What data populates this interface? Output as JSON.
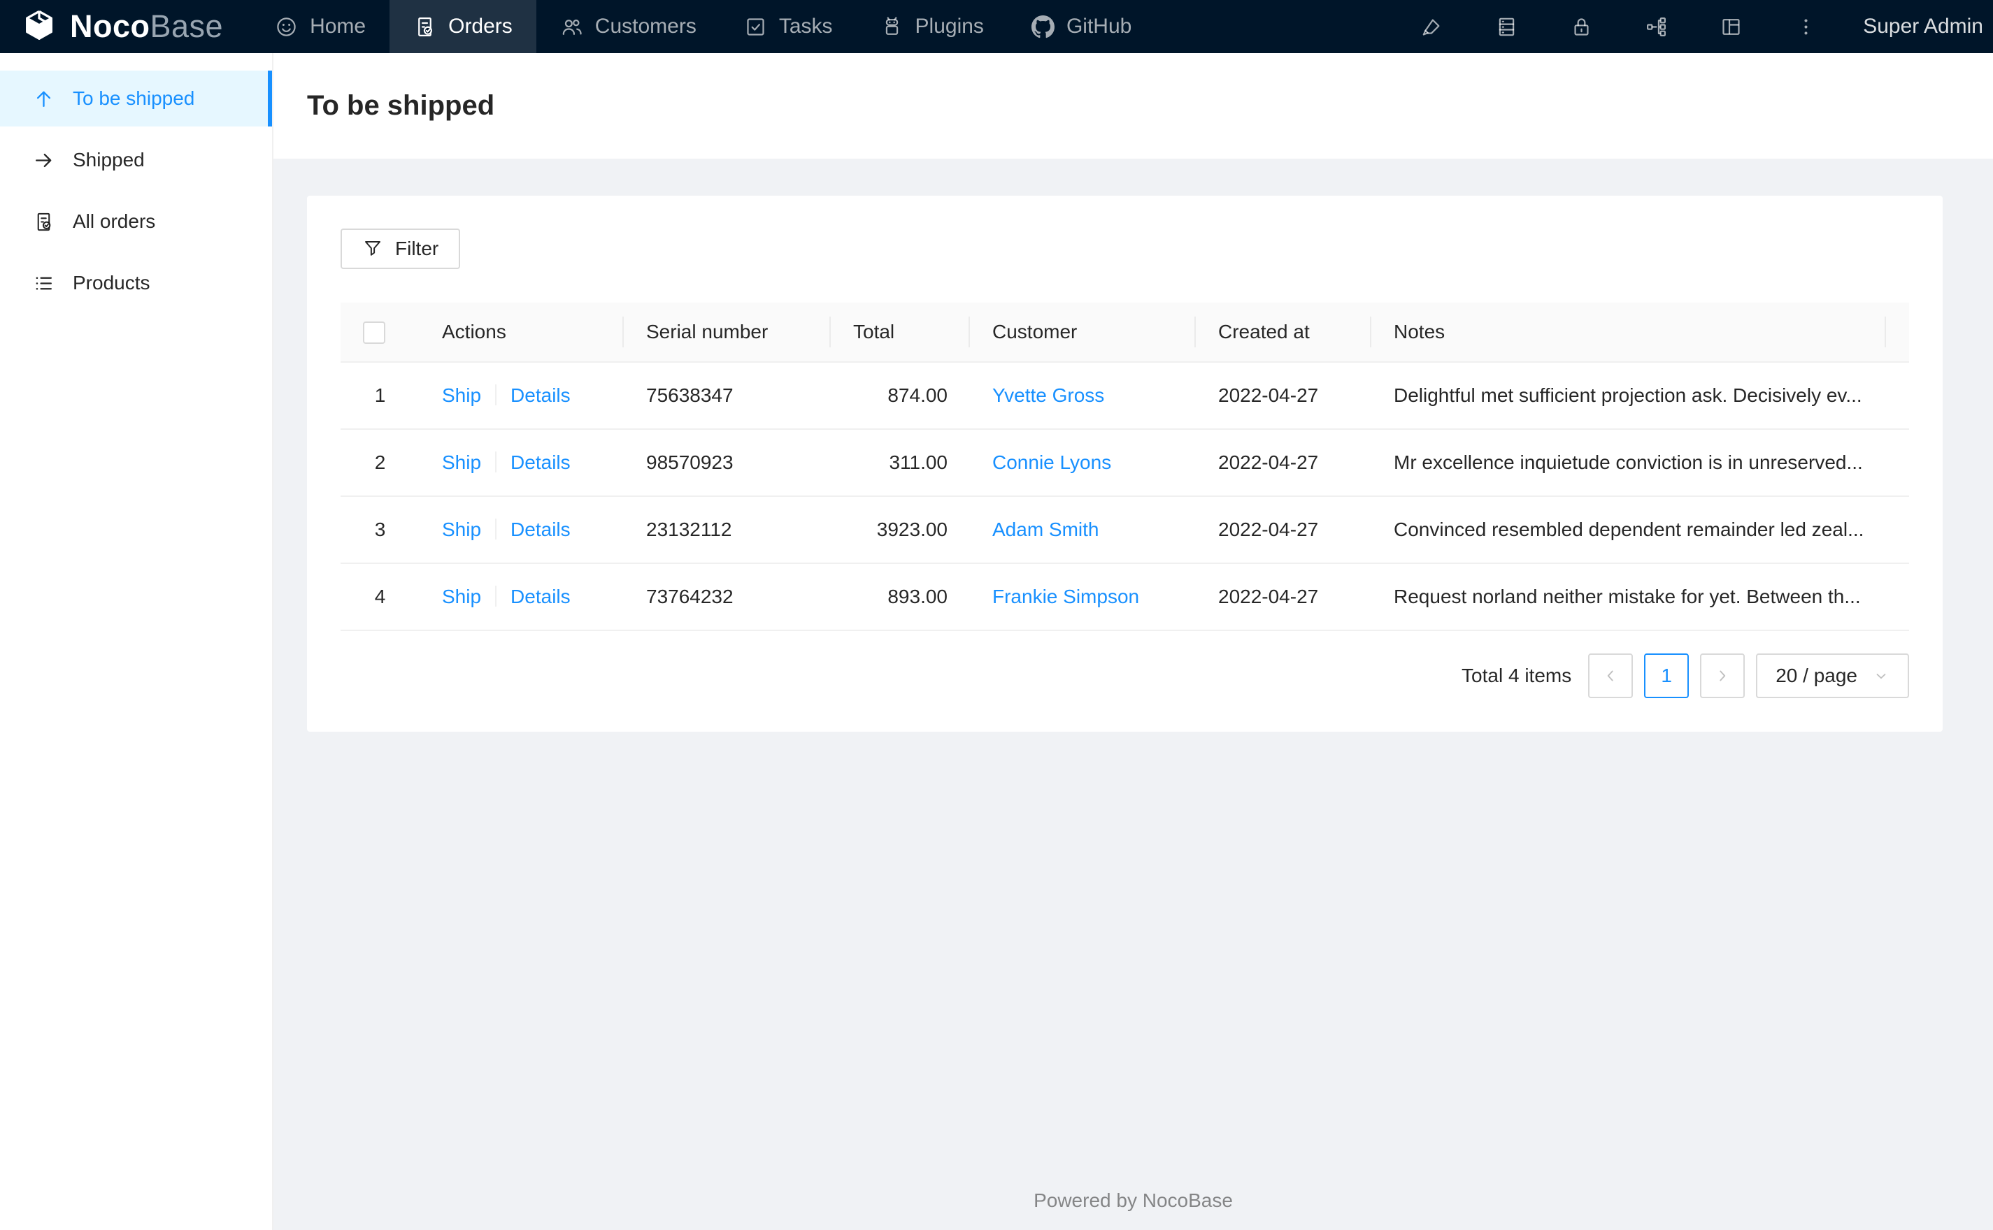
{
  "navbar": {
    "logo": {
      "brand_bold": "Noco",
      "brand_light": "Base"
    },
    "menu": [
      {
        "label": "Home",
        "icon": "smile-icon",
        "active": false
      },
      {
        "label": "Orders",
        "icon": "file-done-icon",
        "active": true
      },
      {
        "label": "Customers",
        "icon": "team-icon",
        "active": false
      },
      {
        "label": "Tasks",
        "icon": "check-square-icon",
        "active": false
      },
      {
        "label": "Plugins",
        "icon": "robot-icon",
        "active": false
      },
      {
        "label": "GitHub",
        "icon": "github-icon",
        "active": false
      }
    ],
    "action_icons": [
      "highlighter-icon",
      "database-icon",
      "lock-icon",
      "cluster-icon",
      "layout-icon",
      "ellipsis-vertical-icon"
    ],
    "user": "Super Admin"
  },
  "sidebar": {
    "items": [
      {
        "label": "To be shipped",
        "icon": "arrow-up-icon",
        "active": true
      },
      {
        "label": "Shipped",
        "icon": "arrow-right-icon",
        "active": false
      },
      {
        "label": "All orders",
        "icon": "file-done-icon",
        "active": false
      },
      {
        "label": "Products",
        "icon": "unordered-list-icon",
        "active": false
      }
    ]
  },
  "page": {
    "title": "To be shipped"
  },
  "toolbar": {
    "filter_label": "Filter"
  },
  "table": {
    "columns": [
      "Actions",
      "Serial number",
      "Total",
      "Customer",
      "Created at",
      "Notes"
    ],
    "action_labels": {
      "ship": "Ship",
      "details": "Details"
    },
    "rows": [
      {
        "index": "1",
        "serial": "75638347",
        "total": "874.00",
        "customer": "Yvette Gross",
        "created_at": "2022-04-27",
        "notes": "Delightful met sufficient projection ask. Decisively ev..."
      },
      {
        "index": "2",
        "serial": "98570923",
        "total": "311.00",
        "customer": "Connie Lyons",
        "created_at": "2022-04-27",
        "notes": "Mr excellence inquietude conviction is in unreserved..."
      },
      {
        "index": "3",
        "serial": "23132112",
        "total": "3923.00",
        "customer": "Adam Smith",
        "created_at": "2022-04-27",
        "notes": "Convinced resembled dependent remainder led zeal..."
      },
      {
        "index": "4",
        "serial": "73764232",
        "total": "893.00",
        "customer": "Frankie Simpson",
        "created_at": "2022-04-27",
        "notes": "Request norland neither mistake for yet. Between th..."
      }
    ]
  },
  "pagination": {
    "total_text": "Total 4 items",
    "prev": "chevron-left-icon",
    "current_page": "1",
    "next": "chevron-right-icon",
    "page_size": "20 / page"
  },
  "footer": {
    "text": "Powered by NocoBase"
  },
  "colors": {
    "primary": "#1890ff",
    "navbar_bg": "#001529",
    "sidebar_active_bg": "#e6f7ff",
    "page_bg": "#f0f2f5",
    "table_header_bg": "#fafafa",
    "border": "#f0f0f0"
  }
}
